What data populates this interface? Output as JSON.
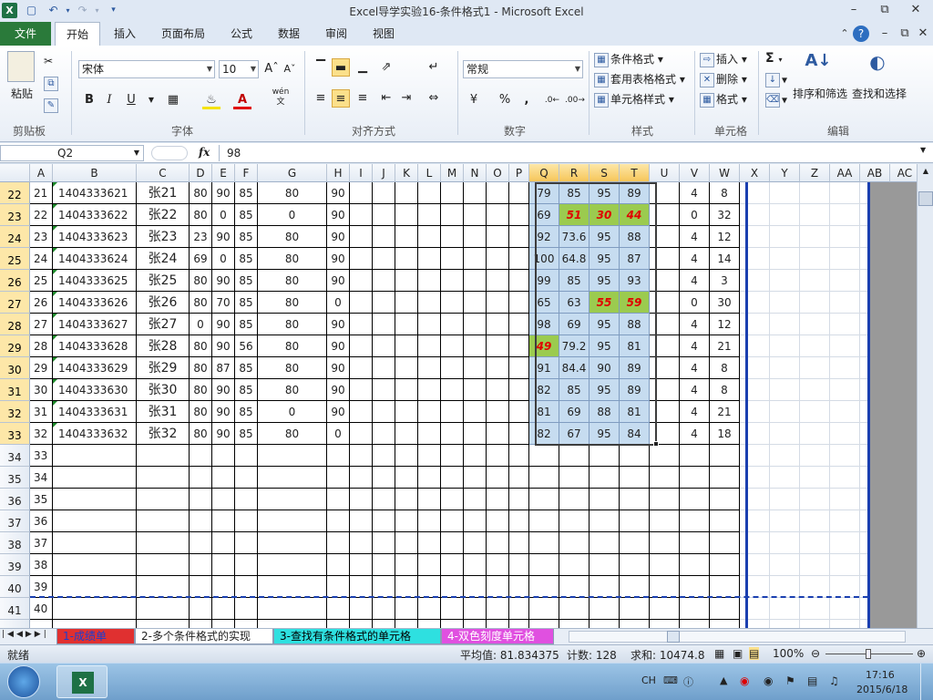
{
  "window": {
    "title": "Excel导学实验16-条件格式1  -  Microsoft Excel"
  },
  "tabs": [
    {
      "label": "文件"
    },
    {
      "label": "开始"
    },
    {
      "label": "插入"
    },
    {
      "label": "页面布局"
    },
    {
      "label": "公式"
    },
    {
      "label": "数据"
    },
    {
      "label": "审阅"
    },
    {
      "label": "视图"
    }
  ],
  "ribbon": {
    "clipboard": {
      "paste": "粘贴",
      "group": "剪贴板"
    },
    "font": {
      "name": "宋体",
      "size": "10",
      "bold": "B",
      "italic": "I",
      "underline": "U",
      "wen": "wén",
      "wen2": "文",
      "group": "字体"
    },
    "alignment": {
      "group": "对齐方式"
    },
    "number": {
      "format": "常规",
      "percent": "%",
      "comma": ",",
      "group": "数字"
    },
    "styles": {
      "cond": "条件格式",
      "table": "套用表格格式",
      "cell": "单元格样式",
      "group": "样式"
    },
    "cells": {
      "insert": "插入",
      "delete": "删除",
      "format": "格式",
      "group": "单元格"
    },
    "editing": {
      "sum": "Σ",
      "sort": "排序和筛选",
      "find": "查找和选择",
      "group": "编辑"
    }
  },
  "formula_bar": {
    "name_box": "Q2",
    "fx": "fx",
    "value": "98"
  },
  "columns": [
    "A",
    "B",
    "C",
    "D",
    "E",
    "F",
    "G",
    "H",
    "I",
    "J",
    "K",
    "L",
    "M",
    "N",
    "O",
    "P",
    "Q",
    "R",
    "S",
    "T",
    "U",
    "V",
    "W",
    "X",
    "Y",
    "Z",
    "AA",
    "AB",
    "AC"
  ],
  "rows": [
    {
      "n": "22",
      "a": "21",
      "b": "1404333621",
      "c": "张21",
      "d": "80",
      "e": "90",
      "f": "85",
      "g": "80",
      "h": "90",
      "q": "79",
      "r": "85",
      "s": "95",
      "t": "89",
      "v": "4",
      "w": "8"
    },
    {
      "n": "23",
      "a": "22",
      "b": "1404333622",
      "c": "张22",
      "d": "80",
      "e": "0",
      "f": "85",
      "g": "0",
      "h": "90",
      "q": "69",
      "r": "51",
      "s": "30",
      "t": "44",
      "v": "0",
      "w": "32"
    },
    {
      "n": "24",
      "a": "23",
      "b": "1404333623",
      "c": "张23",
      "d": "23",
      "e": "90",
      "f": "85",
      "g": "80",
      "h": "90",
      "q": "92",
      "r": "73.6",
      "s": "95",
      "t": "88",
      "v": "4",
      "w": "12"
    },
    {
      "n": "25",
      "a": "24",
      "b": "1404333624",
      "c": "张24",
      "d": "69",
      "e": "0",
      "f": "85",
      "g": "80",
      "h": "90",
      "q": "100",
      "r": "64.8",
      "s": "95",
      "t": "87",
      "v": "4",
      "w": "14"
    },
    {
      "n": "26",
      "a": "25",
      "b": "1404333625",
      "c": "张25",
      "d": "80",
      "e": "90",
      "f": "85",
      "g": "80",
      "h": "90",
      "q": "99",
      "r": "85",
      "s": "95",
      "t": "93",
      "v": "4",
      "w": "3"
    },
    {
      "n": "27",
      "a": "26",
      "b": "1404333626",
      "c": "张26",
      "d": "80",
      "e": "70",
      "f": "85",
      "g": "80",
      "h": "0",
      "q": "65",
      "r": "63",
      "s": "55",
      "t": "59",
      "v": "0",
      "w": "30"
    },
    {
      "n": "28",
      "a": "27",
      "b": "1404333627",
      "c": "张27",
      "d": "0",
      "e": "90",
      "f": "85",
      "g": "80",
      "h": "90",
      "q": "98",
      "r": "69",
      "s": "95",
      "t": "88",
      "v": "4",
      "w": "12"
    },
    {
      "n": "29",
      "a": "28",
      "b": "1404333628",
      "c": "张28",
      "d": "80",
      "e": "90",
      "f": "56",
      "g": "80",
      "h": "90",
      "q": "49",
      "r": "79.2",
      "s": "95",
      "t": "81",
      "v": "4",
      "w": "21"
    },
    {
      "n": "30",
      "a": "29",
      "b": "1404333629",
      "c": "张29",
      "d": "80",
      "e": "87",
      "f": "85",
      "g": "80",
      "h": "90",
      "q": "91",
      "r": "84.4",
      "s": "90",
      "t": "89",
      "v": "4",
      "w": "8"
    },
    {
      "n": "31",
      "a": "30",
      "b": "1404333630",
      "c": "张30",
      "d": "80",
      "e": "90",
      "f": "85",
      "g": "80",
      "h": "90",
      "q": "82",
      "r": "85",
      "s": "95",
      "t": "89",
      "v": "4",
      "w": "8"
    },
    {
      "n": "32",
      "a": "31",
      "b": "1404333631",
      "c": "张31",
      "d": "80",
      "e": "90",
      "f": "85",
      "g": "0",
      "h": "90",
      "q": "81",
      "r": "69",
      "s": "88",
      "t": "81",
      "v": "4",
      "w": "21"
    },
    {
      "n": "33",
      "a": "32",
      "b": "1404333632",
      "c": "张32",
      "d": "80",
      "e": "90",
      "f": "85",
      "g": "80",
      "h": "0",
      "q": "82",
      "r": "67",
      "s": "95",
      "t": "84",
      "v": "4",
      "w": "18"
    },
    {
      "n": "34",
      "a": "33"
    },
    {
      "n": "35",
      "a": "34"
    },
    {
      "n": "36",
      "a": "35"
    },
    {
      "n": "37",
      "a": "36"
    },
    {
      "n": "38",
      "a": "37"
    },
    {
      "n": "39",
      "a": "38"
    },
    {
      "n": "40",
      "a": "39"
    },
    {
      "n": "41",
      "a": "40"
    },
    {
      "n": "42",
      "a": ""
    }
  ],
  "highlighted_cells": [
    "23-r",
    "23-s",
    "23-t",
    "27-s",
    "27-t",
    "29-q"
  ],
  "sheet_tabs": [
    {
      "label": "1-成绩单",
      "color": "#1a3fd0",
      "bg": "#e03030"
    },
    {
      "label": "2-多个条件格式的实现",
      "color": "#000000",
      "bg": "#ffffff"
    },
    {
      "label": "3-查找有条件格式的单元格",
      "color": "#000000",
      "bg": "#2ee0e0"
    },
    {
      "label": "4-双色刻度单元格",
      "color": "#ffffff",
      "bg": "#e050e0"
    }
  ],
  "status": {
    "ready": "就绪",
    "average": "平均值: 81.834375",
    "count": "计数: 128",
    "sum": "求和: 10474.8",
    "zoom": "100%"
  },
  "taskbar": {
    "lang": "CH",
    "time": "17:16",
    "date": "2015/6/18"
  }
}
